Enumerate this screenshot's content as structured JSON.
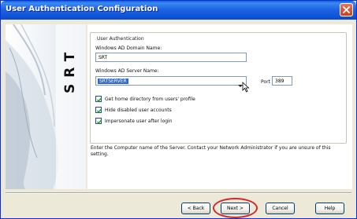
{
  "window": {
    "title": "User Authentication Configuration"
  },
  "banner": {
    "logo_text": "SRT"
  },
  "group": {
    "legend": "User Authentication",
    "domain_label": "Windows AD Domain Name:",
    "domain_value": "SRT",
    "server_label": "Windows AD Server Name:",
    "server_value": "SRTSERVER",
    "port_label": "Port",
    "port_value": "389"
  },
  "options": [
    {
      "label": "Get home directory from users' profile",
      "checked": true
    },
    {
      "label": "Hide disabled user accounts",
      "checked": true
    },
    {
      "label": "Impersonate user after login",
      "checked": true
    }
  ],
  "info_text": "Enter the Computer name of the Server. Contact your Network Administrator if you are unsure of this setting.",
  "buttons": {
    "back": "< Back",
    "next": "Next >",
    "cancel": "Cancel",
    "help": "Help"
  },
  "colors": {
    "title_bar": "#0f55d6",
    "highlight_ring": "#d2282a",
    "selection": "#316ac5"
  }
}
